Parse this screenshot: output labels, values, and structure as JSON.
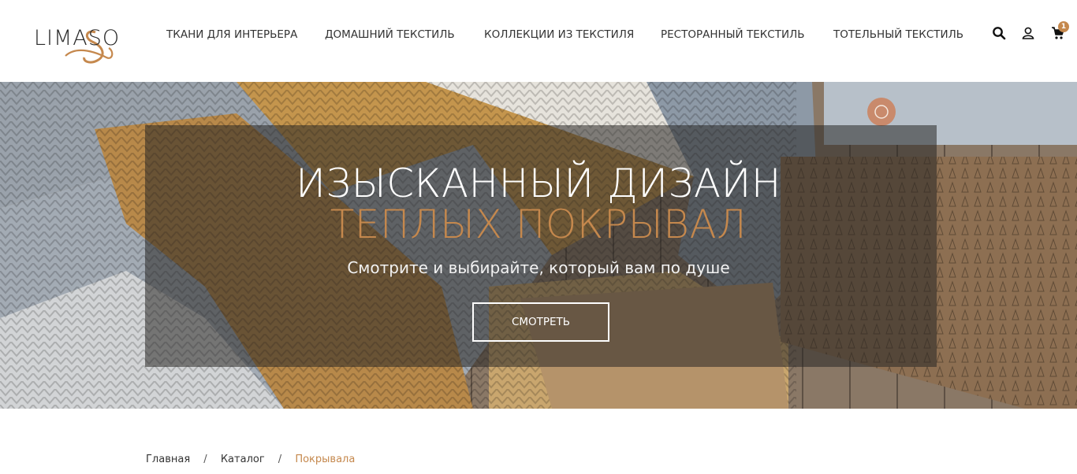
{
  "brand": {
    "logo_text": "LIMASO",
    "accent_color": "#c5884d"
  },
  "nav": {
    "items": [
      {
        "label": "ТКАНИ ДЛЯ ИНТЕРЬЕРА"
      },
      {
        "label": "ДОМАШНИЙ ТЕКСТИЛЬ"
      },
      {
        "label": "КОЛЛЕКЦИИ ИЗ ТЕКСТИЛЯ"
      },
      {
        "label": "РЕСТОРАННЫЙ ТЕКСТИЛЬ"
      },
      {
        "label": "ТОТЕЛЬНЫЙ ТЕКСТИЛЬ"
      }
    ]
  },
  "header_icons": {
    "search": "search-icon",
    "account": "user-icon",
    "cart": "cart-icon",
    "cart_count": "1"
  },
  "hero": {
    "title_line1": "ИЗЫСКАННЫЙ ДИЗАЙН",
    "title_line2": "ТЕПЛЫХ ПОКРЫВАЛ",
    "subtitle": "Смотрите и выбирайте, который вам по душе",
    "button_label": "СМОТРЕТЬ"
  },
  "breadcrumb": {
    "items": [
      "Главная",
      "Каталог",
      "Покрывала"
    ],
    "separator": "/"
  }
}
